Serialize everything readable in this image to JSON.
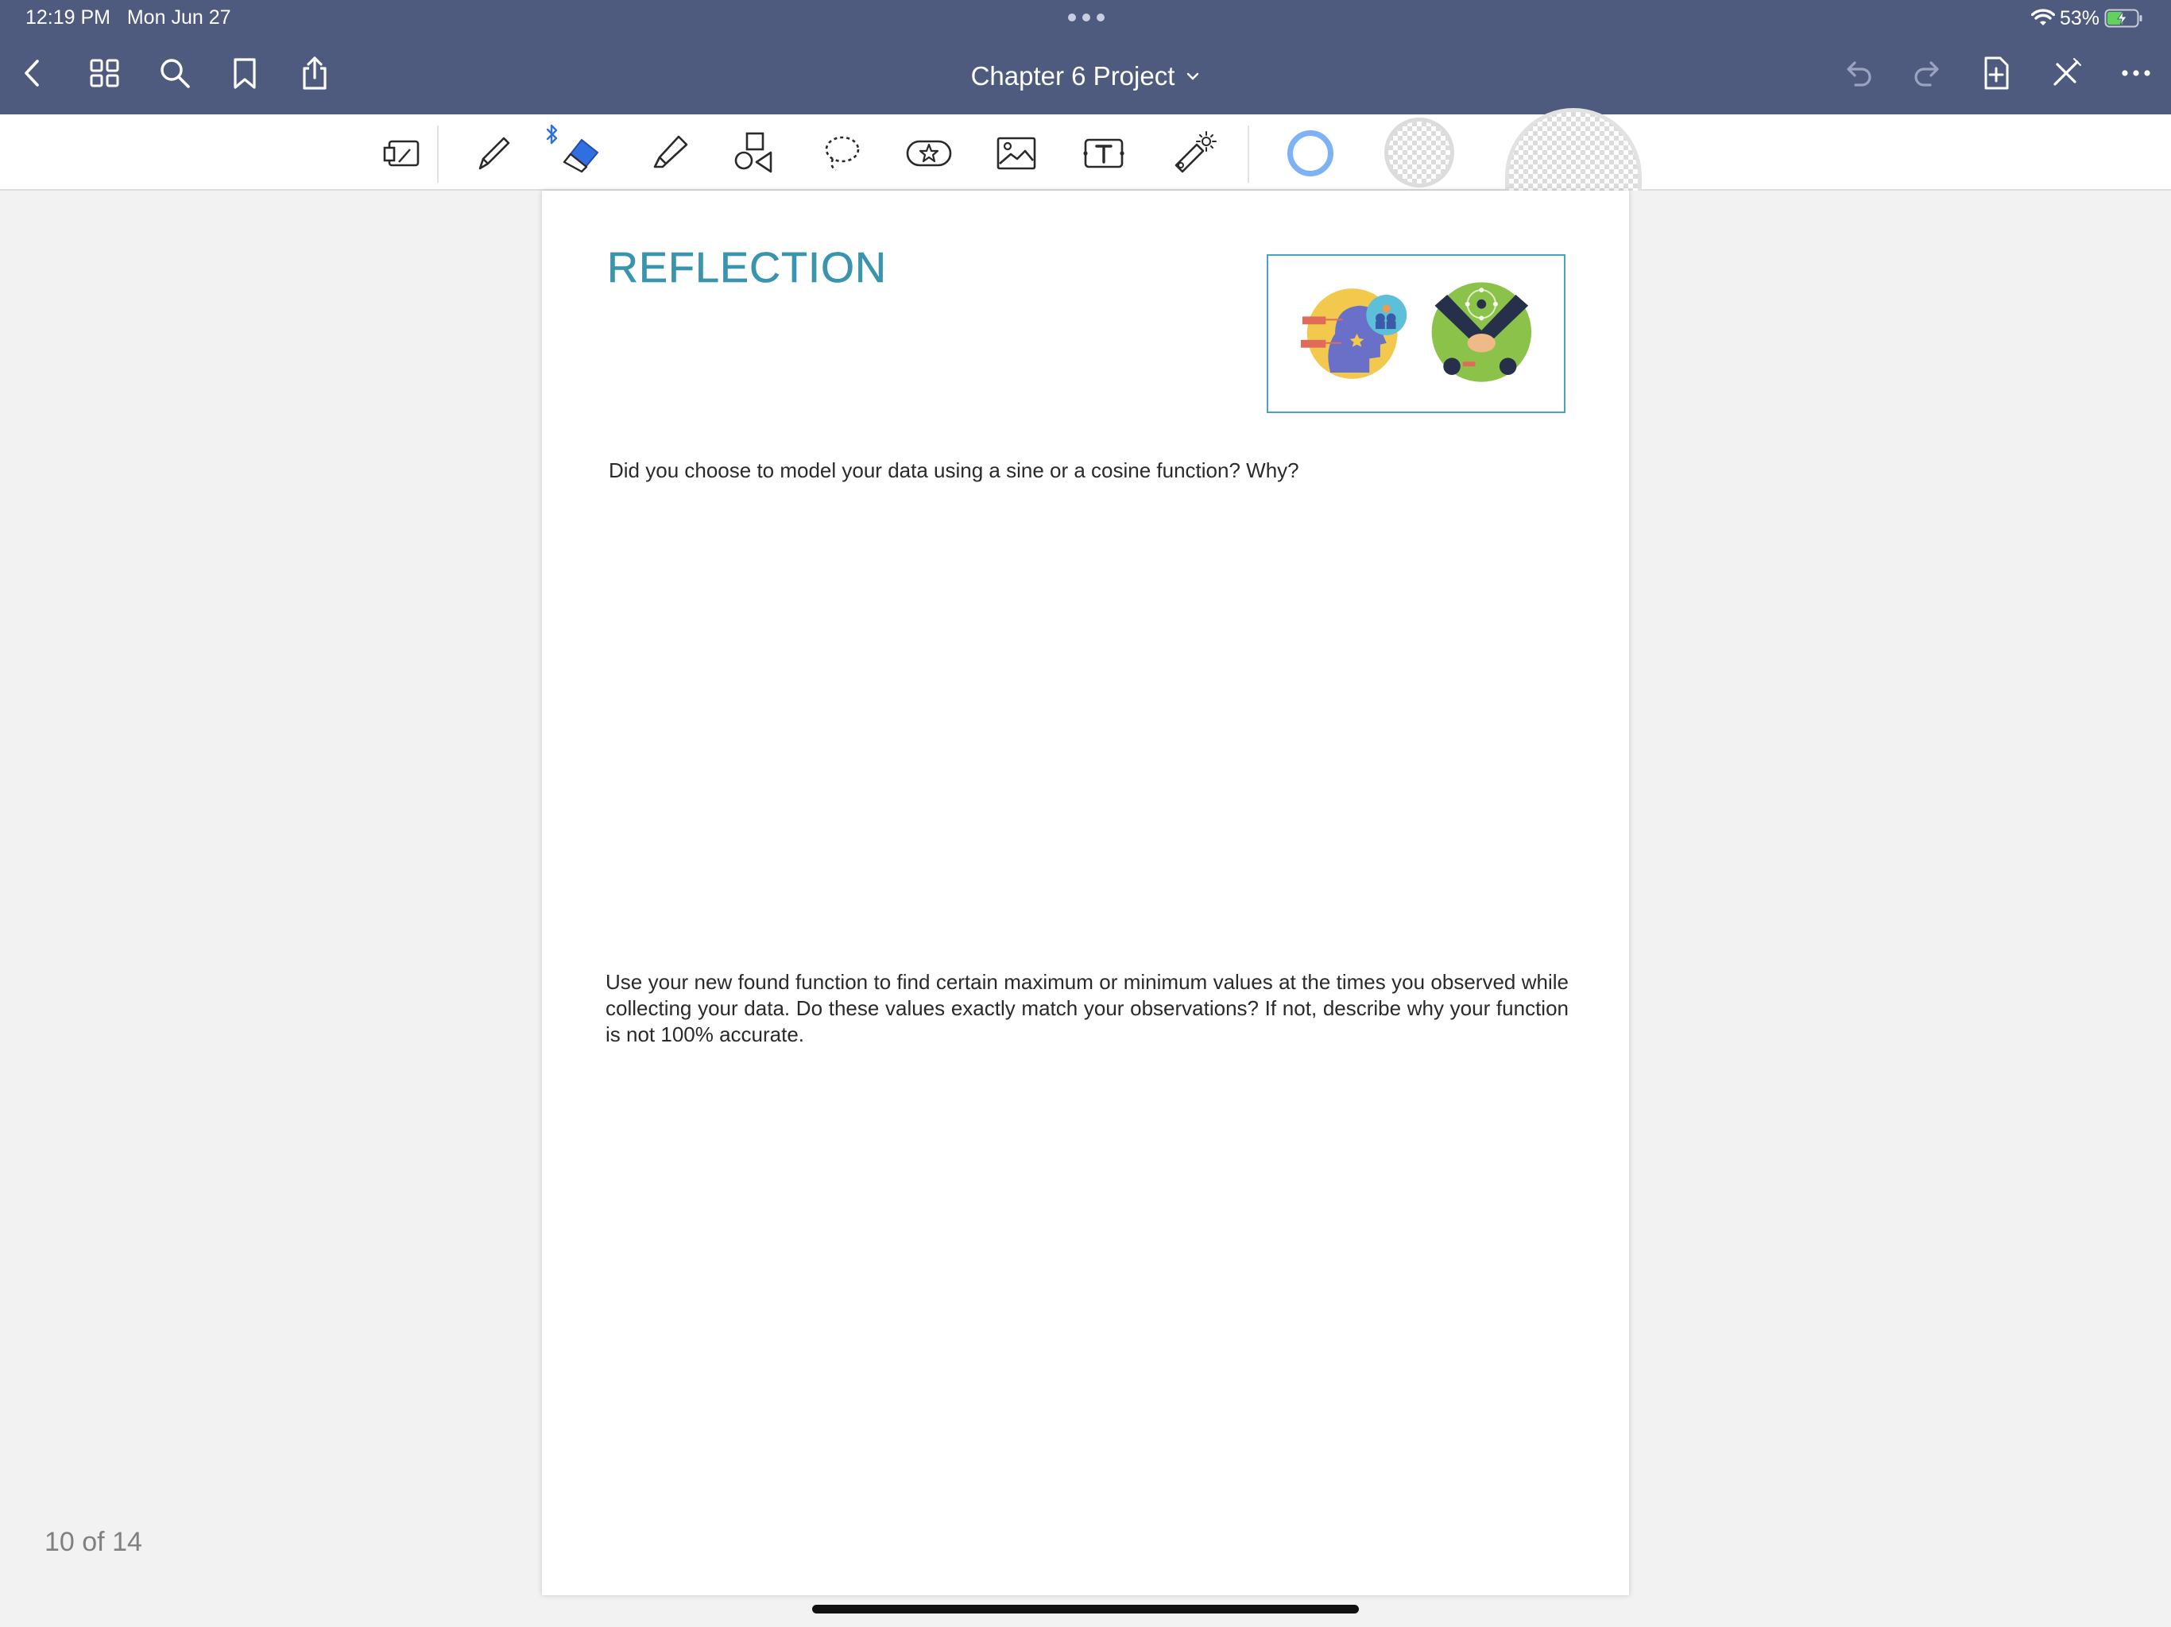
{
  "status_bar": {
    "time": "12:19 PM",
    "date": "Mon Jun 27",
    "battery_percent": "53%",
    "battery_level": 0.53
  },
  "nav": {
    "title": "Chapter 6 Project",
    "left_icons": [
      "chevron-left-icon",
      "grid-icon",
      "search-icon",
      "bookmark-icon",
      "share-icon"
    ],
    "right_icons": [
      "undo-icon",
      "redo-icon",
      "add-page-icon",
      "close-tools-icon",
      "more-icon"
    ]
  },
  "toolbar": {
    "tools": [
      "read-mode-icon",
      "pen-icon",
      "eraser-icon",
      "highlighter-icon",
      "shapes-icon",
      "lasso-icon",
      "elements-icon",
      "image-icon",
      "text-icon",
      "laser-pointer-icon"
    ],
    "selected_tool": "eraser",
    "colors": {
      "accent": "#4a8ff0",
      "nav_background": "#4f5b7e"
    }
  },
  "page": {
    "heading": "REFLECTION",
    "question_1": "Did you choose to model your data using a sine or a cosine function? Why?",
    "question_2": "Use your new found function to find certain maximum or minimum values at the times you observed while collecting your data. Do these values exactly match your observations? If not, describe why your function is not 100% accurate."
  },
  "page_indicator": "10 of 14"
}
